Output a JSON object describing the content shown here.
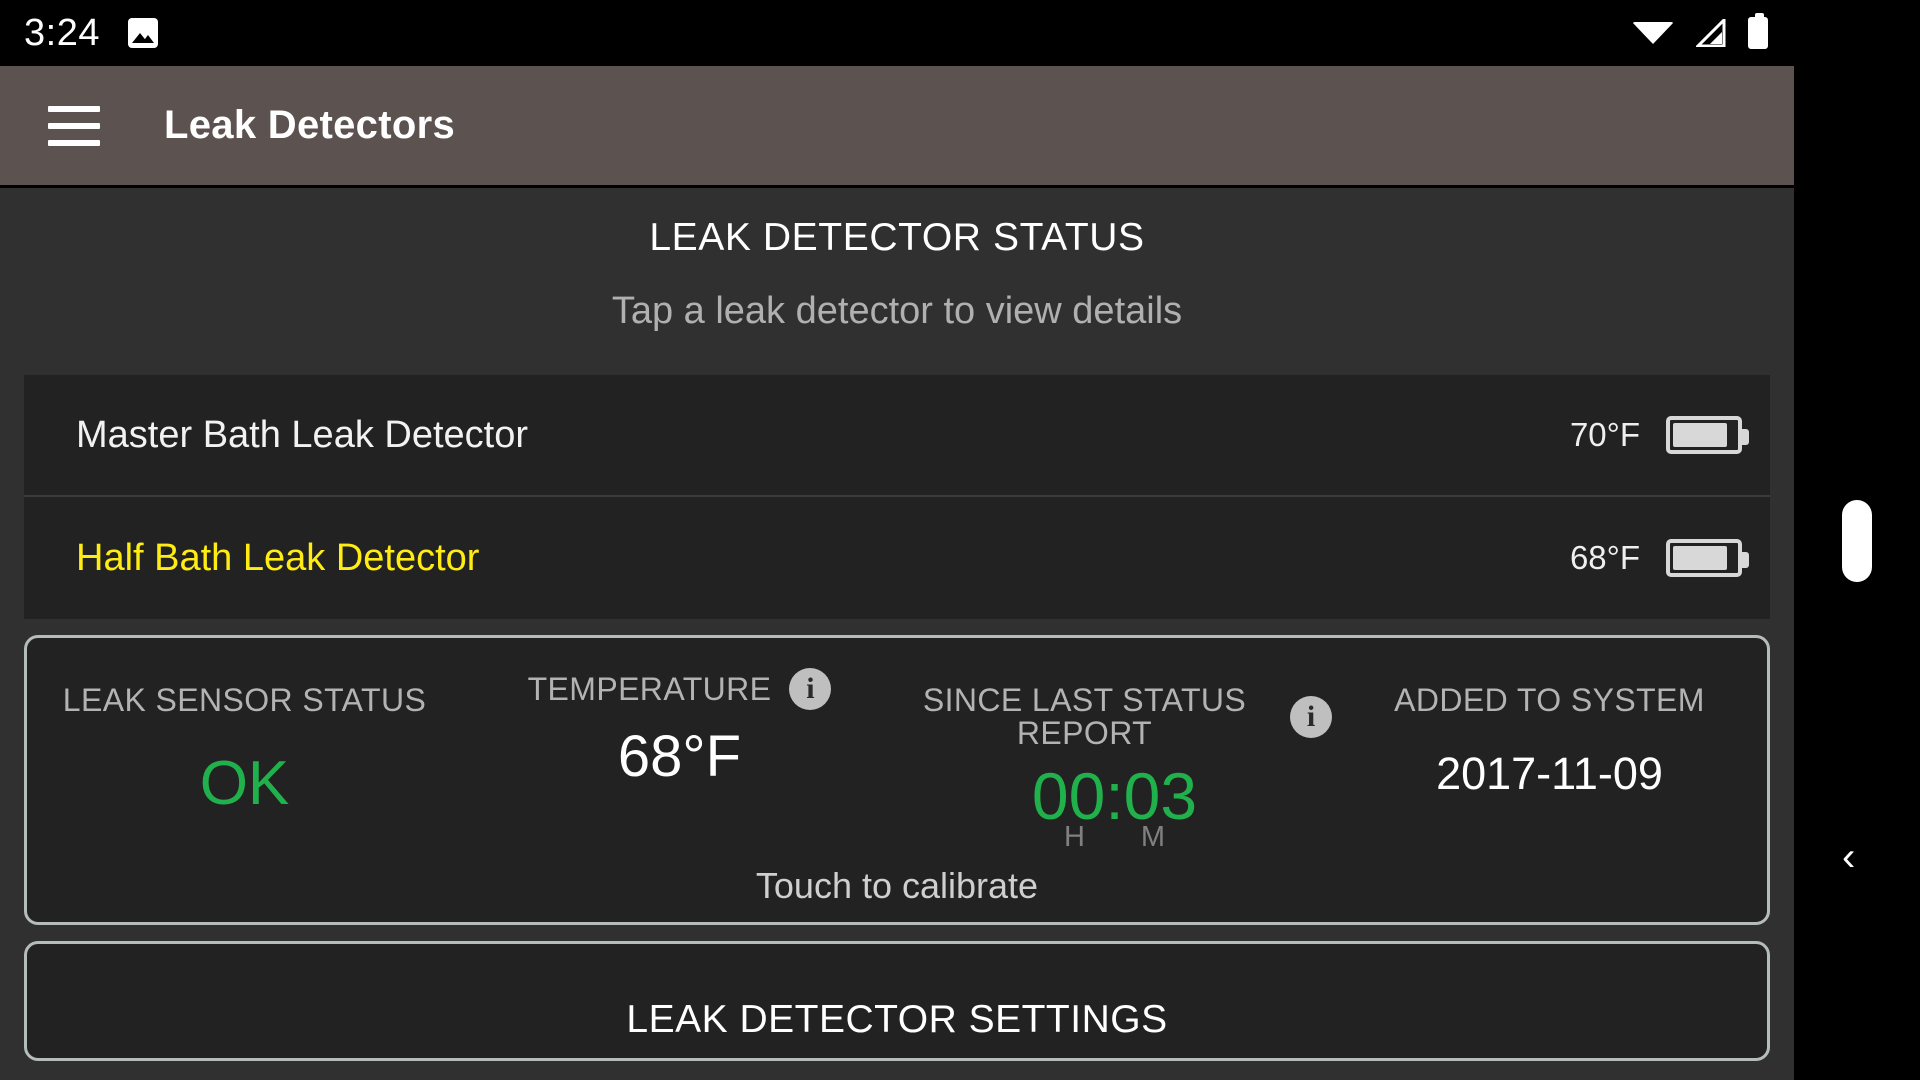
{
  "status_bar": {
    "time": "3:24",
    "left_icons": [
      {
        "name": "screenshot-image-icon"
      }
    ],
    "right_icons": [
      {
        "name": "wifi-icon"
      },
      {
        "name": "cellular-signal-icon"
      },
      {
        "name": "battery-icon"
      }
    ]
  },
  "app_bar": {
    "menu_label": "menu",
    "title": "Leak Detectors"
  },
  "page": {
    "title": "LEAK DETECTOR STATUS",
    "subtitle": "Tap a leak detector to view details"
  },
  "detectors": [
    {
      "name": "Master Bath Leak Detector",
      "temperature": "70°F",
      "battery_level": 88,
      "selected": false
    },
    {
      "name": "Half Bath Leak Detector",
      "temperature": "68°F",
      "battery_level": 88,
      "selected": true
    }
  ],
  "detail_card": {
    "leak_sensor": {
      "label": "LEAK SENSOR STATUS",
      "value": "OK"
    },
    "temperature": {
      "label": "TEMPERATURE",
      "value": "68°F",
      "info_glyph": "i"
    },
    "since_last_report": {
      "label": "SINCE LAST STATUS REPORT",
      "value": "00:03",
      "unit_hours": "H",
      "unit_minutes": "M",
      "info_glyph": "i"
    },
    "added_to_system": {
      "label": "ADDED TO SYSTEM",
      "value": "2017-11-09"
    },
    "calibrate_hint": "Touch to calibrate"
  },
  "settings_card": {
    "title": "LEAK DETECTOR SETTINGS"
  },
  "nav": {
    "back_glyph": "‹"
  },
  "colors": {
    "appbar": "#5c5250",
    "page_bg": "#303030",
    "card_bg": "#222222",
    "card_border": "#b4bdb9",
    "selected_text": "#ffec14",
    "ok_green": "#21b14c",
    "label_gray": "#b3b3b3"
  }
}
